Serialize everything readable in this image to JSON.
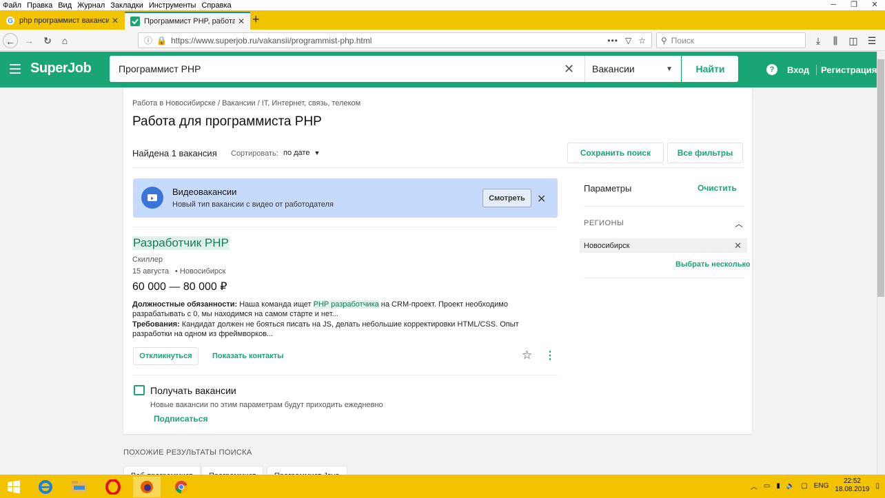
{
  "menubar": [
    "Файл",
    "Правка",
    "Вид",
    "Журнал",
    "Закладки",
    "Инструменты",
    "Справка"
  ],
  "tabs": [
    {
      "label": "php программист вакансии -"
    },
    {
      "label": "Программист PHP, работа пр"
    }
  ],
  "nav": {
    "url": "https://www.superjob.ru/vakansii/programmist-php.html",
    "search_placeholder": "Поиск"
  },
  "header": {
    "logo": "SuperJob",
    "query": "Программист PHP",
    "category": "Вакансии",
    "find_label": "Найти",
    "help": "?",
    "login": "Вход",
    "register": "Регистрация"
  },
  "page": {
    "breadcrumbs": "Работа в Новосибирске / Вакансии / IT, Интернет, связь, телеком",
    "title": "Работа для программиста PHP",
    "found": "Найдена 1 вакансия",
    "sort_label": "Сортировать:",
    "sort_value": "по дате",
    "save_search": "Сохранить поиск",
    "all_filters": "Все фильтры"
  },
  "video_banner": {
    "title": "Видеовакансии",
    "subtitle": "Новый тип вакансии с видео от работодателя",
    "watch": "Смотреть"
  },
  "vacancy": {
    "title": "Разработчик PHP",
    "company": "Скиллер",
    "date": "15 августа",
    "city": "• Новосибирск",
    "salary": "60 000 — 80 000 ₽",
    "duties_label": "Должностные обязанности:",
    "duties_pre": " Наша команда ищет ",
    "duties_hl": "PHP разработчика",
    "duties_post": " на CRM-проект. Проект необходимо разрабатывать с 0, мы находимся на самом старте и нет...",
    "req_label": "Требования:",
    "req_text": " Кандидат должен не бояться писать на JS, делать небольшие корректировки HTML/CSS. Опыт разработки на одном из фреймворков...",
    "apply": "Откликнуться",
    "show_contacts": "Показать контакты"
  },
  "subscribe": {
    "title": "Получать вакансии",
    "subtitle": "Новые вакансии по этим параметрам будут приходить ежедневно",
    "button": "Подписаться"
  },
  "params": {
    "title": "Параметры",
    "clear": "Очистить",
    "regions_label": "РЕГИОНЫ",
    "region": "Новосибирск",
    "select_multiple": "Выбрать несколько"
  },
  "similar": {
    "title": "ПОХОЖИЕ РЕЗУЛЬТАТЫ ПОИСКА",
    "items": [
      "Веб-программист",
      "Программист",
      "Программист Java"
    ]
  },
  "tray": {
    "lang": "ENG",
    "time": "22:52",
    "date": "18.08.2019"
  },
  "colors": {
    "brand": "#1aa575",
    "firefox_chrome": "#f2c400",
    "video_banner": "#c6dbfb"
  }
}
